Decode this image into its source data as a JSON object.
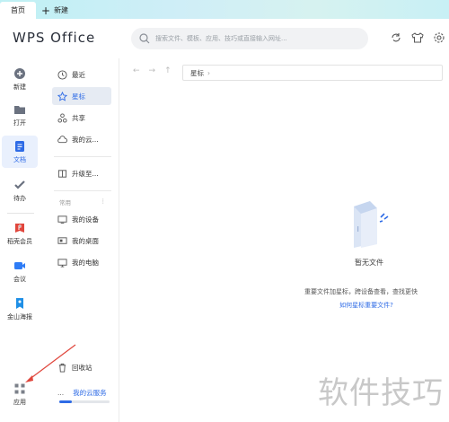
{
  "tabs": {
    "home": "首页",
    "new": "新建"
  },
  "header": {
    "logo": "WPS Office",
    "search_placeholder": "搜索文件、模板、应用、技巧或直接输入网址..."
  },
  "rail": {
    "items": [
      {
        "label": "新建",
        "icon": "plus-circle-icon"
      },
      {
        "label": "打开",
        "icon": "folder-icon"
      },
      {
        "label": "文档",
        "icon": "document-icon"
      },
      {
        "label": "待办",
        "icon": "check-icon"
      },
      {
        "label": "稻壳会员",
        "icon": "daoke-icon"
      },
      {
        "label": "会议",
        "icon": "video-icon"
      },
      {
        "label": "金山海报",
        "icon": "poster-icon"
      },
      {
        "label": "应用",
        "icon": "apps-grid-icon"
      }
    ]
  },
  "nav": {
    "items": [
      {
        "label": "最近",
        "icon": "clock-icon"
      },
      {
        "label": "星标",
        "icon": "star-icon"
      },
      {
        "label": "共享",
        "icon": "share-icon"
      },
      {
        "label": "我的云...",
        "icon": "cloud-icon"
      },
      {
        "label": "升级至...",
        "icon": "upgrade-icon"
      }
    ],
    "section_label": "常用",
    "section_more": "⋮",
    "common": [
      {
        "label": "我的设备",
        "icon": "device-icon"
      },
      {
        "label": "我的桌面",
        "icon": "desktop-icon"
      },
      {
        "label": "我的电脑",
        "icon": "computer-icon"
      }
    ],
    "recycle": "回收站",
    "cloud_service_dots": "...",
    "cloud_service": "我的云服务",
    "cloud_usage": 0.25
  },
  "content": {
    "breadcrumb": "星标",
    "breadcrumb_chevron": "›",
    "nav_back": "←",
    "nav_forward": "→",
    "nav_up": "↑",
    "empty_title": "暂无文件",
    "empty_desc": "重要文件加星标，跨设备查看，查找更快",
    "empty_link": "如何星标重要文件?"
  },
  "watermark": "软件技巧",
  "colors": {
    "accent": "#2e6be6",
    "arrow": "#e0463c"
  }
}
